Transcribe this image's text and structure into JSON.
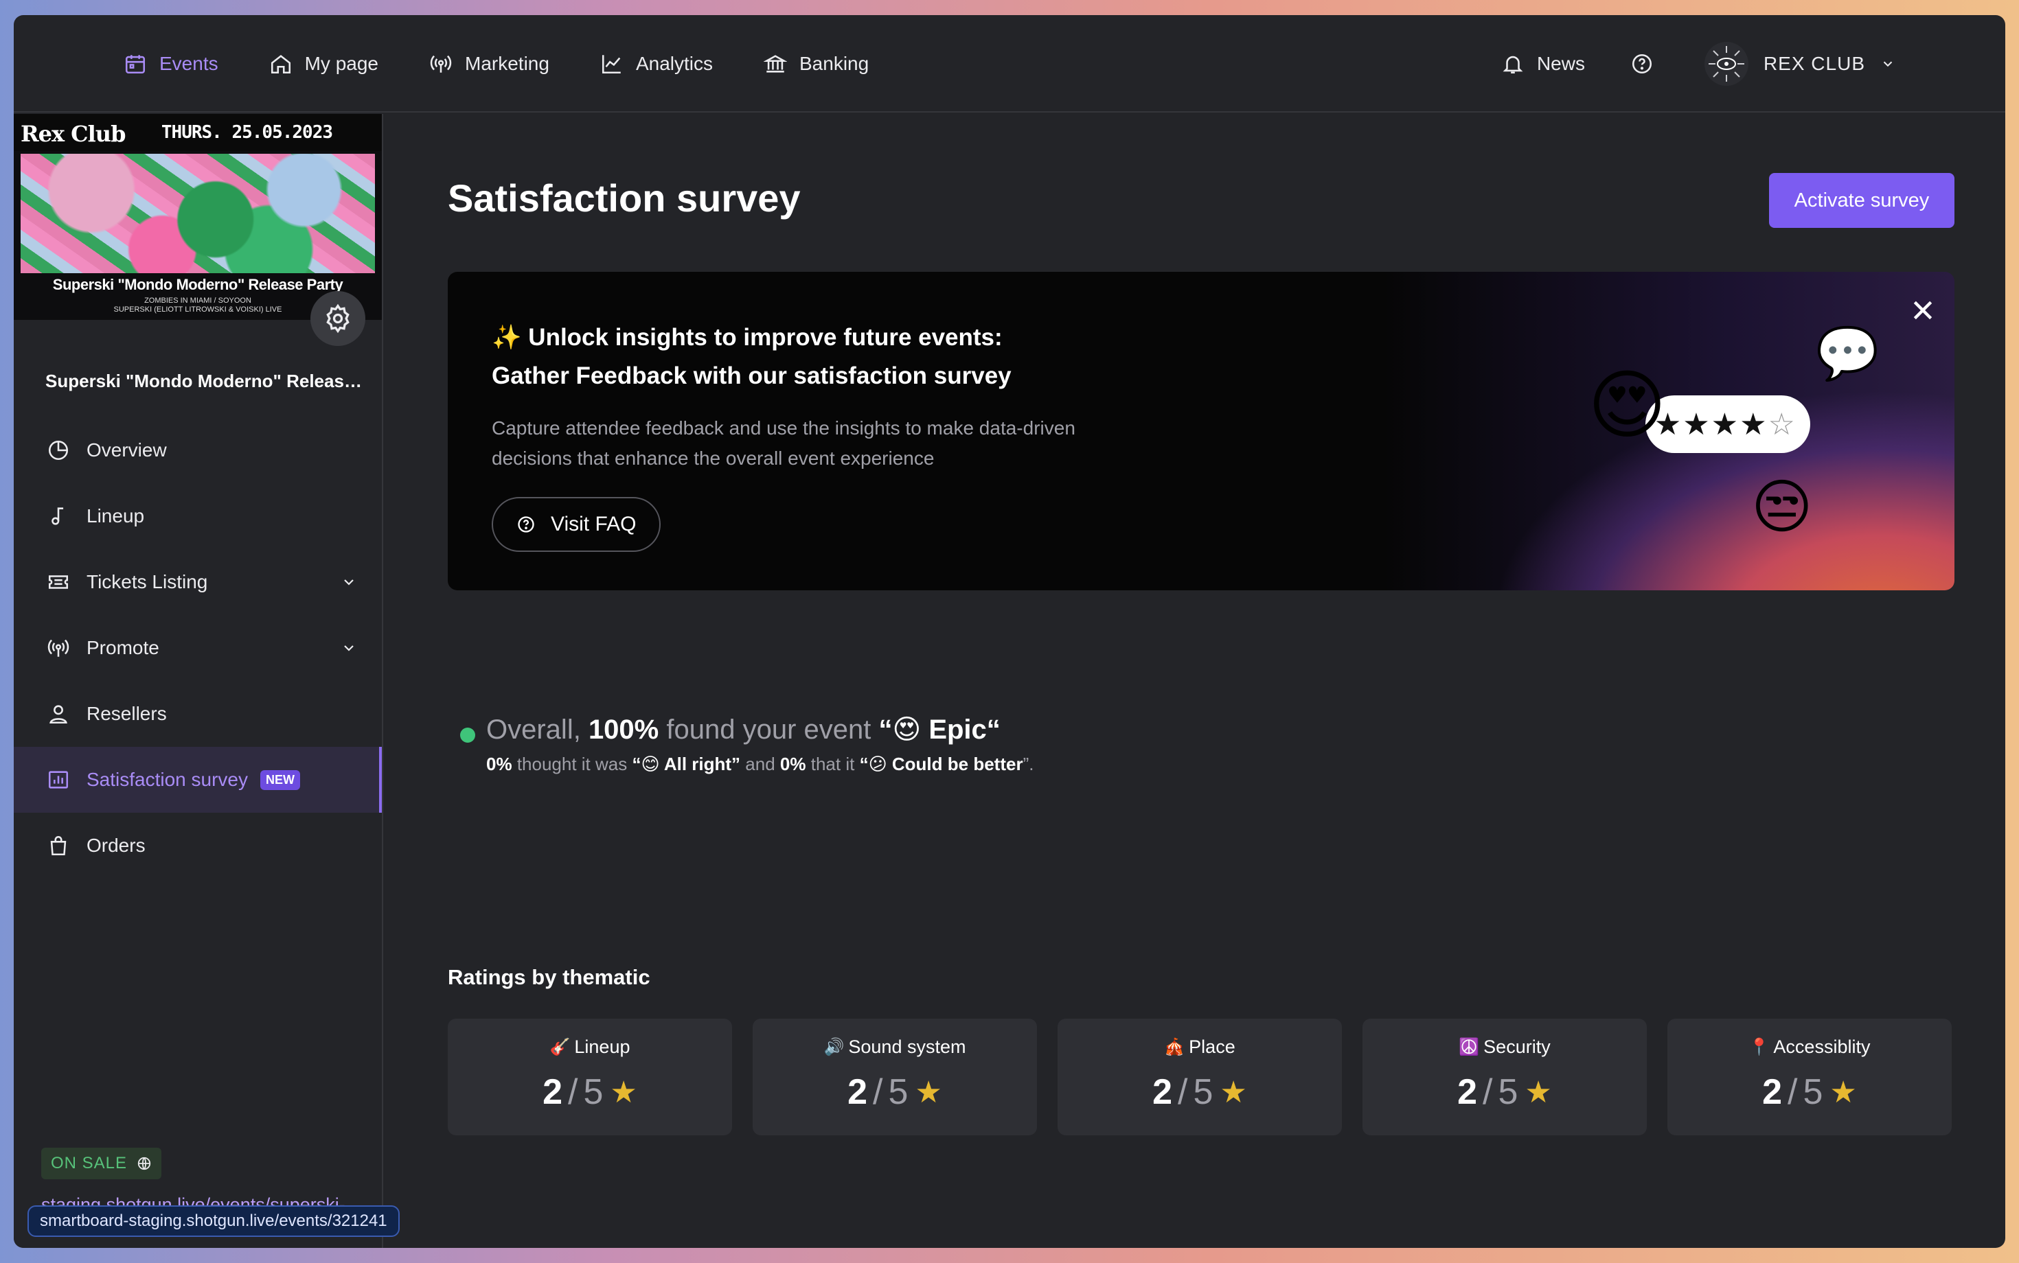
{
  "nav": {
    "items": [
      {
        "label": "Events",
        "icon": "calendar-icon",
        "active": true
      },
      {
        "label": "My page",
        "icon": "home-icon"
      },
      {
        "label": "Marketing",
        "icon": "broadcast-icon"
      },
      {
        "label": "Analytics",
        "icon": "line-chart-icon"
      },
      {
        "label": "Banking",
        "icon": "bank-icon"
      }
    ],
    "news": "News",
    "org_name": "REX CLUB"
  },
  "sidebar": {
    "poster": {
      "brand": "Rex Club",
      "date": "THURS. 25.05.2023",
      "title": "Superski \"Mondo Moderno\" Release Party",
      "sub1": "ZOMBIES IN MIAMI / SOYOON",
      "sub2": "SUPERSKI (ELIOTT LITROWSKI & VOISKI) LIVE"
    },
    "event_name": "Superski \"Mondo Moderno\" Release Party",
    "items": [
      {
        "label": "Overview",
        "icon": "pie-chart-icon"
      },
      {
        "label": "Lineup",
        "icon": "music-note-icon"
      },
      {
        "label": "Tickets Listing",
        "icon": "ticket-icon",
        "expandable": true
      },
      {
        "label": "Promote",
        "icon": "broadcast-icon",
        "expandable": true
      },
      {
        "label": "Resellers",
        "icon": "user-icon"
      },
      {
        "label": "Satisfaction survey",
        "icon": "bar-chart-icon",
        "active": true,
        "badge": "NEW"
      },
      {
        "label": "Orders",
        "icon": "shopping-bag-icon"
      }
    ],
    "status": "ON SALE",
    "link": "staging.shotgun.live/events/superski-mondo-moderno-release-party",
    "status_url": "smartboard-staging.shotgun.live/events/321241"
  },
  "main": {
    "title": "Satisfaction survey",
    "activate_label": "Activate survey",
    "banner": {
      "heading_line1": "✨ Unlock insights to improve future events:",
      "heading_line2": "Gather Feedback with our satisfaction survey",
      "text_line1": "Capture attendee feedback and use the insights to make data-driven",
      "text_line2": "decisions that enhance the overall event experience",
      "faq_label": "Visit FAQ",
      "stars": "★★★★",
      "empty_star": "☆"
    },
    "overall": {
      "prefix": "Overall,",
      "percent": "100%",
      "middle": "found your event",
      "rating": "“😍 Epic“",
      "l2_p1": "0%",
      "l2_t1": "thought it was",
      "l2_r1": "“😊 All right”",
      "l2_t2": "and",
      "l2_p2": "0%",
      "l2_t3": "that it",
      "l2_r2": "“😕 Could be better",
      "l2_end": "”."
    },
    "ratings_title": "Ratings by thematic",
    "ratings": [
      {
        "emoji": "🎸",
        "label": "Lineup",
        "score": "2",
        "max": "5"
      },
      {
        "emoji": "🔊",
        "label": "Sound system",
        "score": "2",
        "max": "5"
      },
      {
        "emoji": "🎪",
        "label": "Place",
        "score": "2",
        "max": "5"
      },
      {
        "emoji": "☮️",
        "label": "Security",
        "score": "2",
        "max": "5"
      },
      {
        "emoji": "📍",
        "label": "Accessiblity",
        "score": "2",
        "max": "5"
      }
    ]
  },
  "colors": {
    "accent": "#7c5cf1",
    "accent_text": "#a98cf6",
    "success": "#3fc47a",
    "star": "#e6b830"
  }
}
